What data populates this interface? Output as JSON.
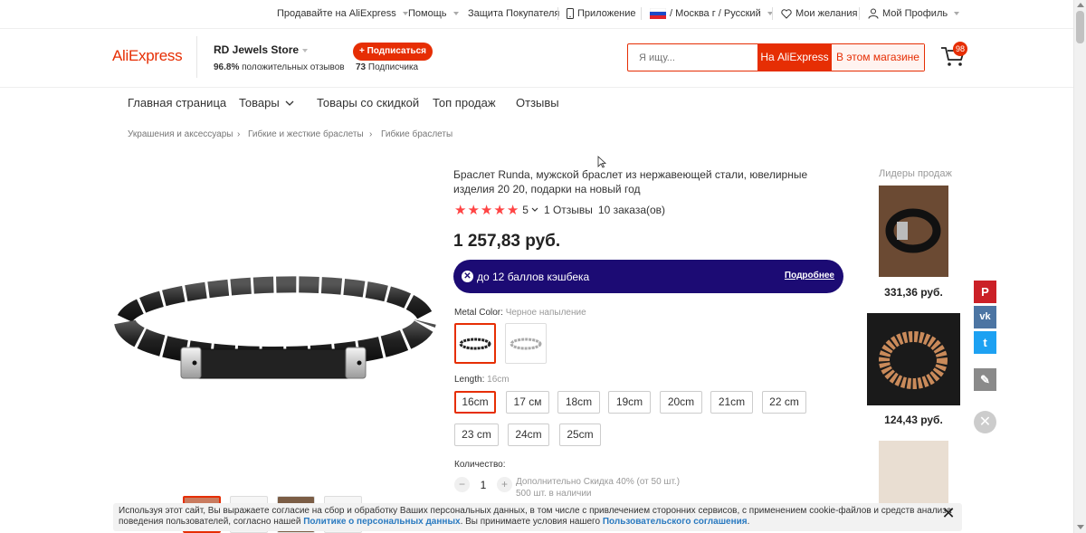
{
  "topbar": {
    "sell": "Продавайте на AliExpress",
    "help": "Помощь",
    "protection": "Защита Покупателя",
    "app": "Приложение",
    "region": "/ Москва г / Русский",
    "wishlist": "Мои желания",
    "profile": "Мой Профиль"
  },
  "header": {
    "logo": "AliExpress",
    "store_name": "RD Jewels Store",
    "feedback_percent": "96.8%",
    "feedback_label": "положительных отзывов",
    "subscribe_label": "+ Подписаться",
    "subscribers_count": "73",
    "subscribers_label": "Подписчика",
    "search_placeholder": "Я ищу...",
    "search_ali_label": "На AliExpress",
    "search_store_label": "В этом магазине",
    "cart_count": "98"
  },
  "nav": {
    "items": [
      "Главная страница",
      "Товары",
      "Товары со скидкой",
      "Топ продаж",
      "Отзывы"
    ]
  },
  "breadcrumb": [
    "Украшения и аксессуары",
    "Гибкие и жесткие браслеты",
    "Гибкие браслеты"
  ],
  "product": {
    "title": "Браслет Runda, мужской браслет из нержавеющей стали, ювелирные изделия 20 20, подарки на новый год",
    "rating": "5",
    "reviews": "1 Отзывы",
    "orders": "10 заказа(ов)",
    "price": "1 257,83 руб.",
    "cashback_text": "до 12 баллов кэшбека",
    "cashback_more": "Подробнее",
    "color_label": "Metal Color:",
    "color_value": "Черное напыление",
    "length_label": "Length:",
    "length_value": "16cm",
    "sizes": [
      "16cm",
      "17 см",
      "18cm",
      "19cm",
      "20cm",
      "21cm",
      "22 cm",
      "23 cm",
      "24cm",
      "25cm"
    ],
    "selected_size": "16cm",
    "qty_label": "Количество:",
    "qty_value": "1",
    "qty_discount": "Дополнительно Скидка 40% (от 50 шт.)",
    "qty_stock": "500 шт. в наличии"
  },
  "bestsellers": {
    "title": "Лидеры продаж",
    "items": [
      {
        "price": "331,36 руб."
      },
      {
        "price": "124,43 руб."
      }
    ]
  },
  "social": {
    "pinterest": "P",
    "vk": "vk",
    "twitter": "t",
    "edit": "✎",
    "close": "✕"
  },
  "cookie": {
    "text1": "Используя этот сайт, Вы выражаете согласие на сбор и обработку Ваших персональных данных, в том числе с привлечением сторонних сервисов, с применением cookie-файлов и средств анализа поведения пользователей, согласно нашей ",
    "link1": "Политике о персональных данных",
    "text2": ". Вы принимаете условия нашего ",
    "link2": "Пользовательского соглашения",
    "text3": "."
  },
  "colors": {
    "accent": "#e62e04",
    "cashback_bg": "#1c0b74",
    "pinterest": "#cb2027",
    "vk": "#4c75a3",
    "twitter": "#1da1f2",
    "edit": "#8a8a8a"
  }
}
